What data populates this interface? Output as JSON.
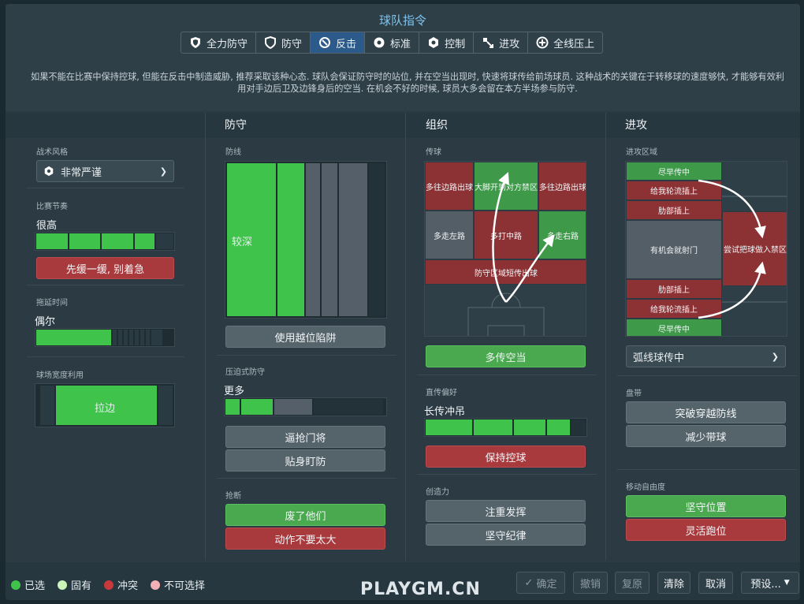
{
  "title": "球队指令",
  "tabs": [
    {
      "label": "全力防守",
      "icon": "shield-double-icon"
    },
    {
      "label": "防守",
      "icon": "shield-icon"
    },
    {
      "label": "反击",
      "icon": "counter-icon",
      "active": true
    },
    {
      "label": "标准",
      "icon": "ball-icon"
    },
    {
      "label": "控制",
      "icon": "control-icon"
    },
    {
      "label": "进攻",
      "icon": "attack-icon"
    },
    {
      "label": "全线压上",
      "icon": "all-out-attack-icon"
    }
  ],
  "description": "如果不能在比赛中保持控球, 但能在反击中制造威胁, 推荐采取该种心态. 球队会保证防守时的站位, 并在空当出现时, 快速将球传给前场球员. 这种战术的关键在于转移球的速度够快, 才能够有效利用对手边后卫及边锋身后的空当. 在机会不好的时候, 球员大多会留在本方半场参与防守.",
  "left": {
    "style_label": "战术风格",
    "style_value": "非常严谨",
    "tempo_label": "比赛节奏",
    "tempo_value": "很高",
    "tempo_level": 0.8,
    "tempo_btn": "先缓一缓, 别着急",
    "timewasting_label": "拖延时间",
    "timewasting_value": "偶尔",
    "timewasting_level": 0.5,
    "width_label": "球场宽度利用",
    "width_value": "拉边",
    "width_level": 0.7
  },
  "defence": {
    "head": "防守",
    "line_label": "防线",
    "line_value": "较深",
    "line_level": 0.35,
    "offside_btn": "使用越位陷阱",
    "press_label": "压迫式防守",
    "press_value": "更多",
    "press_level": 0.55,
    "btn1": "逼抢门将",
    "btn2": "贴身盯防",
    "tackle_label": "抢断",
    "tackle_green": "废了他们",
    "tackle_red": "动作不要太大"
  },
  "organisation": {
    "head": "组织",
    "pass_label": "传球",
    "pitch": {
      "tl": "多往边路出球",
      "tc": "大脚开到对方禁区",
      "tr": "多往边路出球",
      "ml": "多走左路",
      "mc": "多打中路",
      "mr": "多走右路",
      "bottom": "防守区域短传出球"
    },
    "btn_green": "多传空当",
    "direct_label": "直传偏好",
    "direct_value": "长传冲吊",
    "direct_level": 0.8,
    "btn_red": "保持控球",
    "creative_label": "创造力",
    "btn_c1": "注重发挥",
    "btn_c2": "坚守纪律"
  },
  "attack": {
    "head": "进攻",
    "zone_label": "进攻区域",
    "pitch": {
      "r1": "尽早传中",
      "r2": "给我轮流插上",
      "r3": "肋部插上",
      "center": "有机会就射门",
      "box": "尝试把球做入禁区",
      "r4": "肋部插上",
      "r5": "给我轮流插上",
      "r6": "尽早传中"
    },
    "cross_value": "弧线球传中",
    "dribble_label": "盘带",
    "btn_d1": "突破穿越防线",
    "btn_d2": "减少带球",
    "freedom_label": "移动自由度",
    "btn_green": "坚守位置",
    "btn_red": "灵活跑位"
  },
  "legend": [
    {
      "label": "已选",
      "color": "#3fc34a"
    },
    {
      "label": "固有",
      "color": "#c9f5b8"
    },
    {
      "label": "冲突",
      "color": "#c8393d"
    },
    {
      "label": "不可选择",
      "color": "#f3b0b5"
    }
  ],
  "footer": {
    "confirm": "确定",
    "undo": "撤销",
    "redo": "复原",
    "clear": "清除",
    "cancel": "取消",
    "preset": "预设..."
  },
  "watermark": "PLAYGM.CN"
}
